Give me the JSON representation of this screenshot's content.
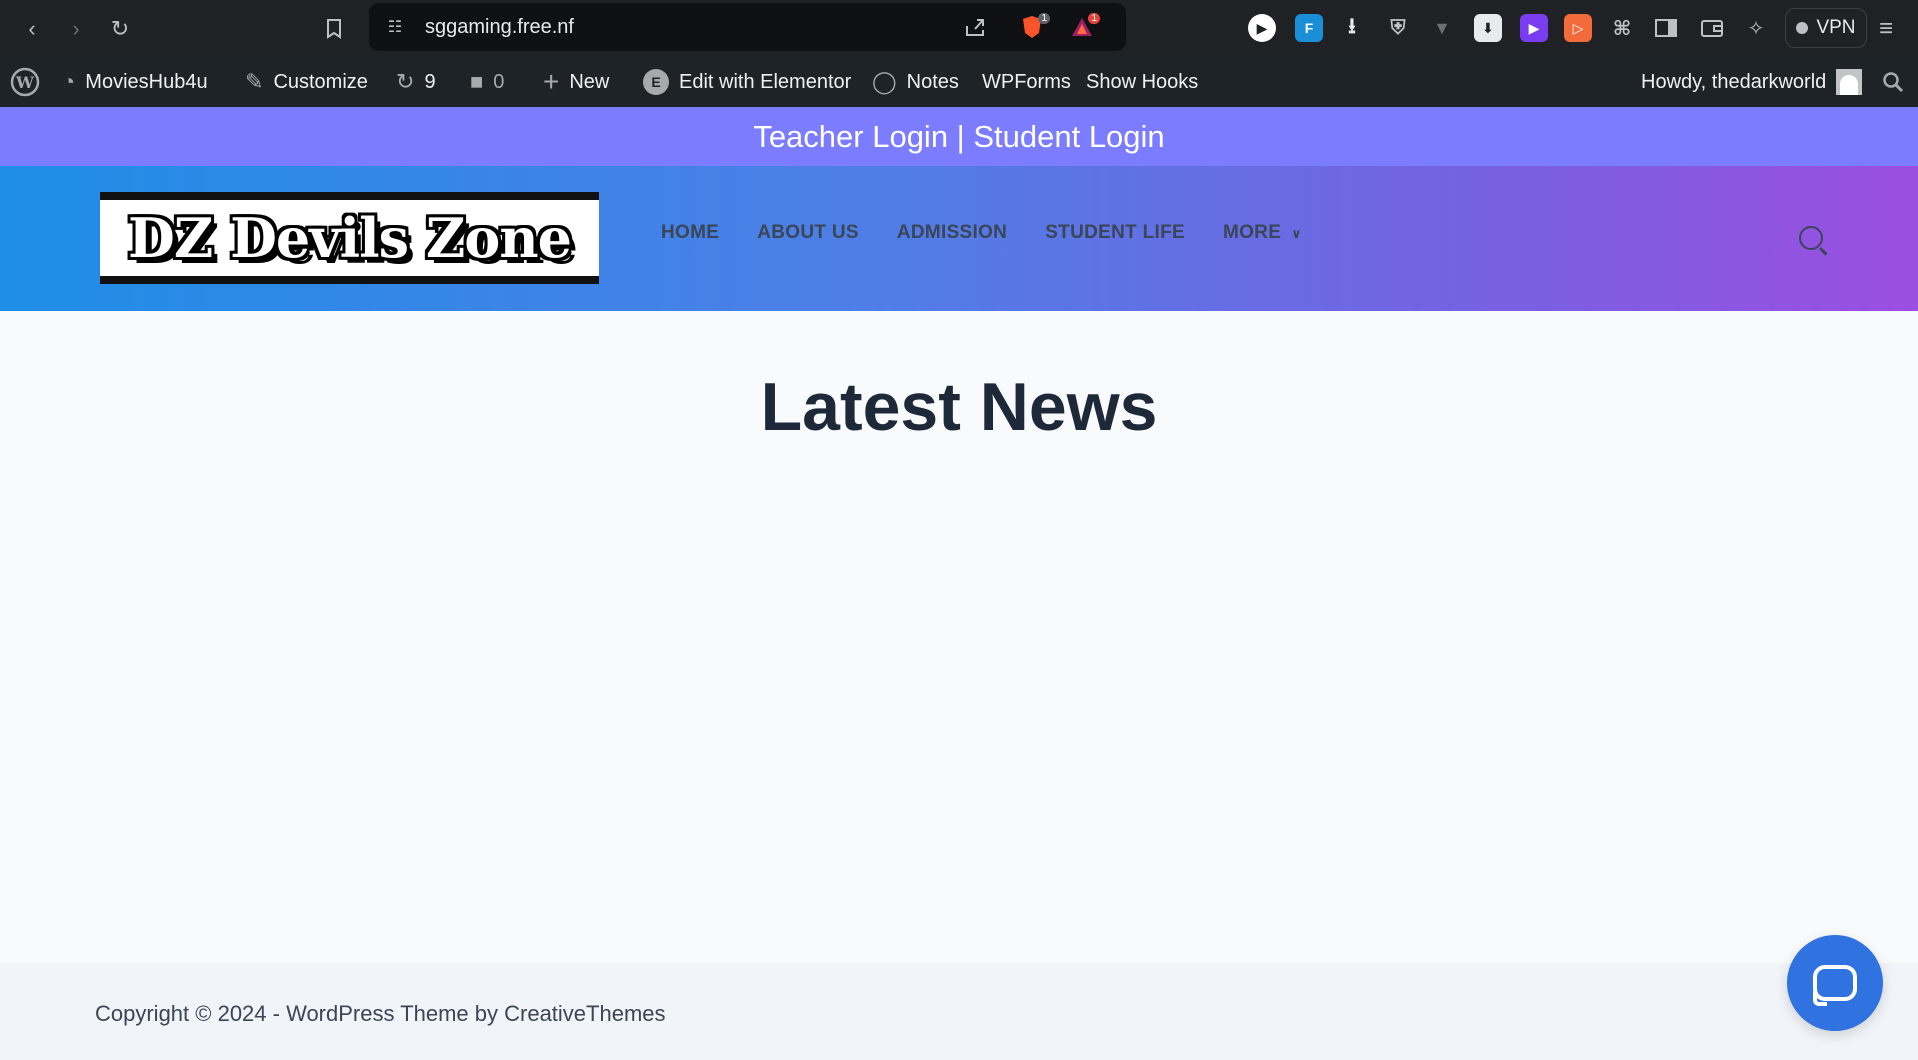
{
  "browser": {
    "url": "sggaming.free.nf",
    "vpn_label": "VPN",
    "brave_badge": "1",
    "alert_badge": "1"
  },
  "adminbar": {
    "site_name": "MoviesHub4u",
    "customize": "Customize",
    "updates_count": "9",
    "comments_count": "0",
    "new": "New",
    "elementor": "Edit with Elementor",
    "notes": "Notes",
    "wpforms": "WPForms",
    "show_hooks": "Show Hooks",
    "howdy": "Howdy, thedarkworld"
  },
  "topbar": {
    "text": "Teacher Login | Student Login"
  },
  "header": {
    "logo_text": "DZ Devils Zone",
    "menu": [
      "HOME",
      "ABOUT US",
      "ADMISSION",
      "STUDENT LIFE",
      "MORE"
    ]
  },
  "main": {
    "title": "Latest News"
  },
  "footer": {
    "copyright": "Copyright © 2024 - WordPress Theme by CreativeThemes"
  },
  "colors": {
    "topbar_bg": "#7b7cff",
    "header_gradient_start": "#1e8ee6",
    "header_gradient_end": "#9b4ee0",
    "chat_button": "#2f72e0"
  }
}
